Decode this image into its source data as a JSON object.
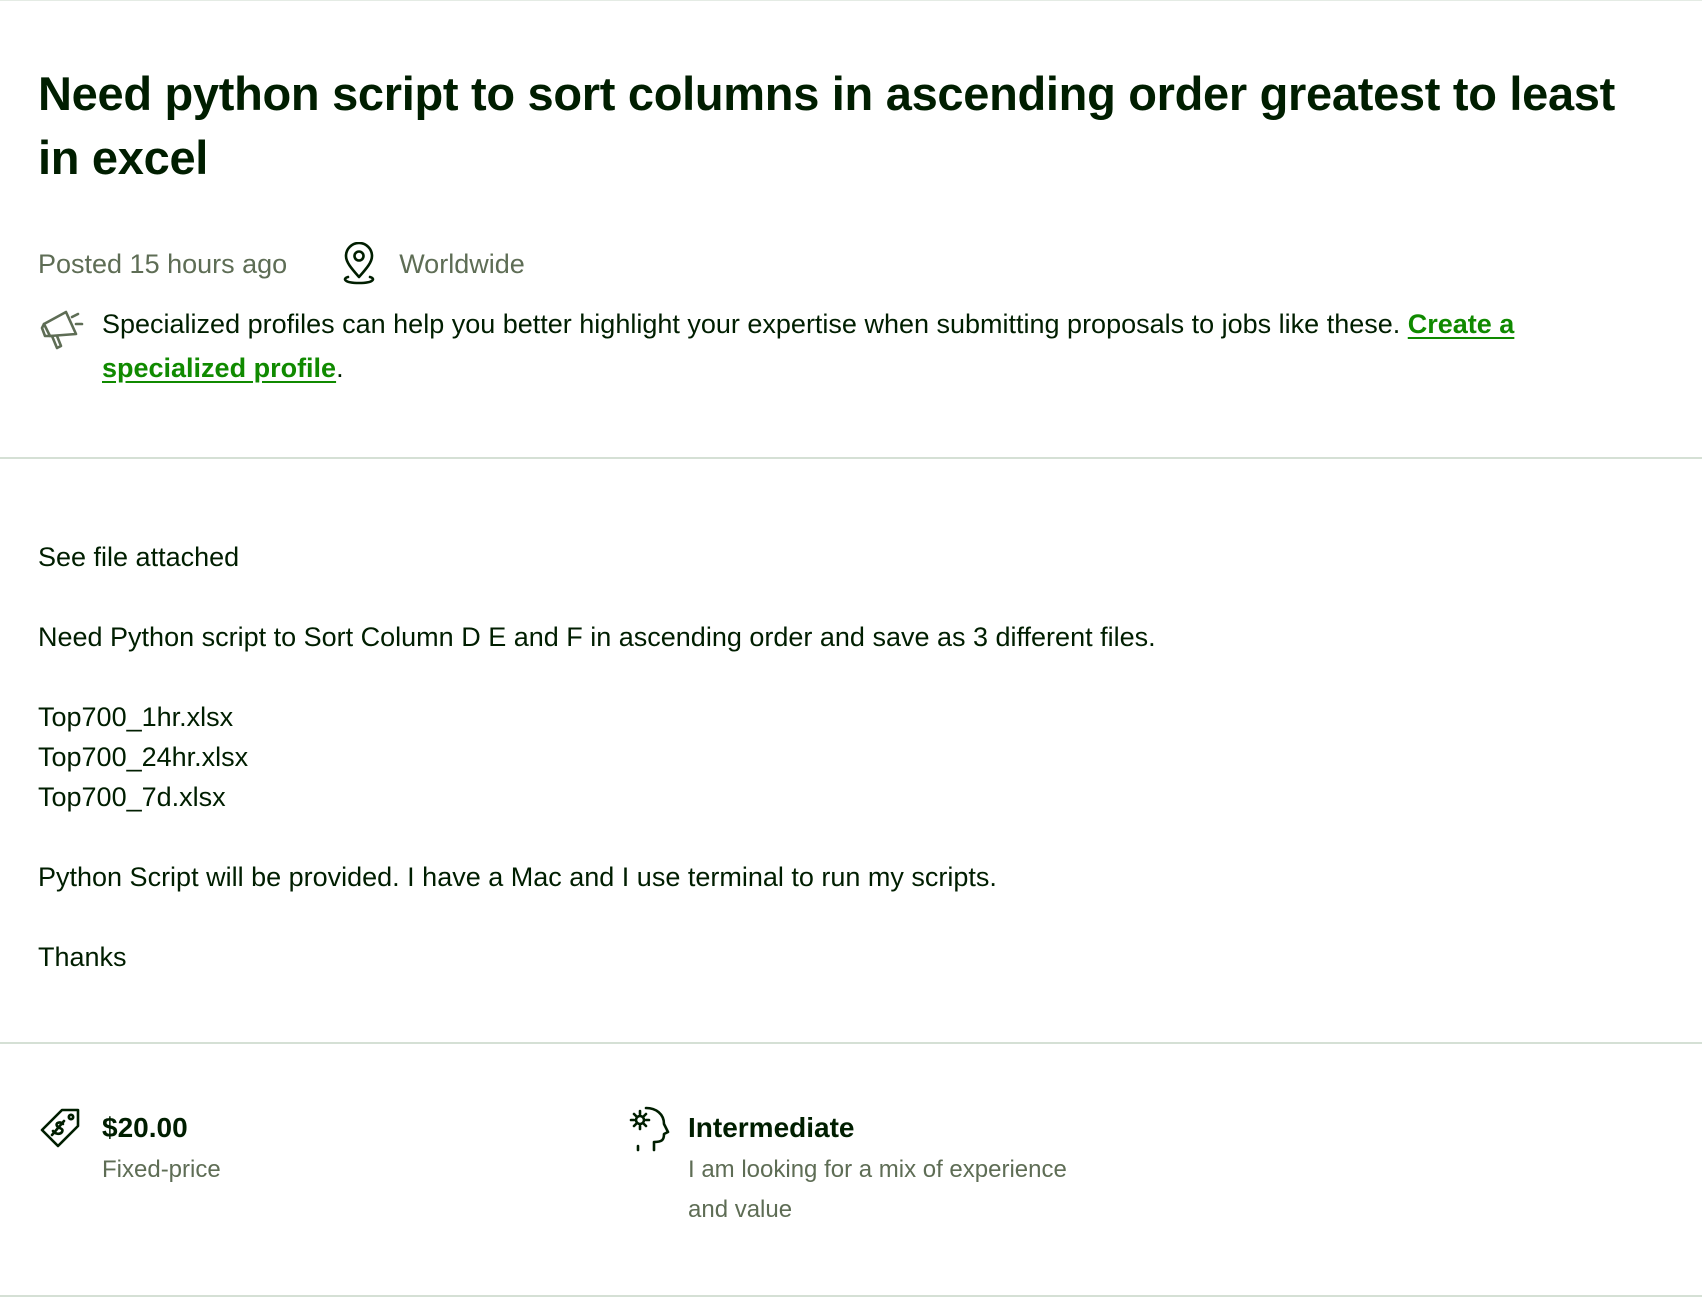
{
  "job": {
    "title": "Need python script to sort columns in ascending order greatest to least in excel",
    "posted": "Posted 15 hours ago",
    "location": "Worldwide",
    "location_icon": "map-pin-icon"
  },
  "promo": {
    "icon": "megaphone-icon",
    "text": "Specialized profiles can help you better highlight your expertise when submitting proposals to jobs like these. ",
    "link_label": "Create a specialized profile",
    "suffix": "."
  },
  "description": {
    "line1": "See file attached",
    "line2": "Need Python script to Sort Column D E and F in ascending order and save as 3 different files.",
    "files": [
      "Top700_1hr.xlsx",
      "Top700_24hr.xlsx",
      "Top700_7d.xlsx"
    ],
    "line3": "Python Script will be provided. I have a Mac and I use terminal to run my scripts.",
    "line4": "Thanks"
  },
  "features": {
    "price": {
      "icon": "price-tag-icon",
      "amount": "$20.00",
      "type": "Fixed-price"
    },
    "experience": {
      "icon": "expertise-head-icon",
      "level": "Intermediate",
      "description": "I am looking for a mix of experience and value"
    }
  },
  "colors": {
    "text": "#001e00",
    "muted": "#5e6d55",
    "link": "#108a00",
    "divider": "#d5e0d5"
  }
}
